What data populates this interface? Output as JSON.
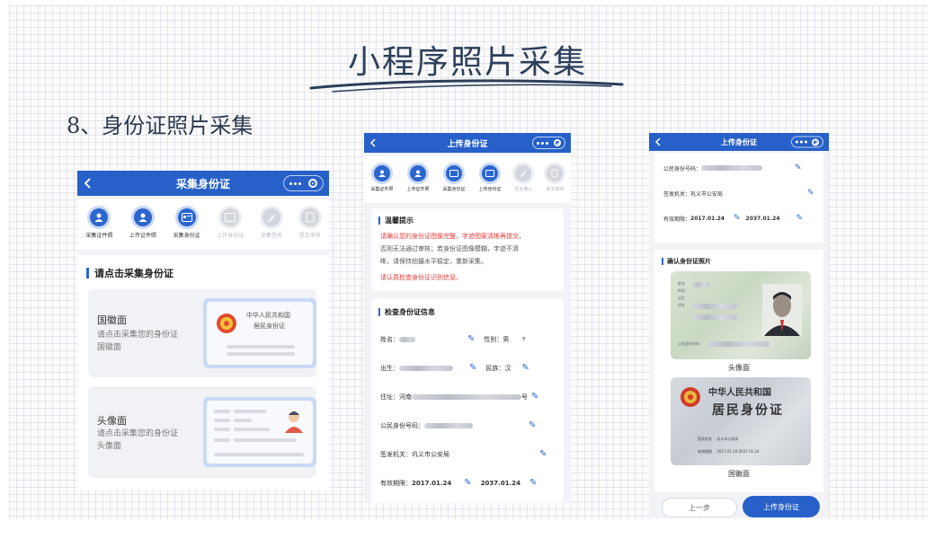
{
  "slide": {
    "title": "小程序照片采集",
    "section_heading": "8、身份证照片采集"
  },
  "colors": {
    "primary": "#2760c8",
    "step_active": "#2c66cf",
    "warning": "#e53a3a"
  },
  "phone1": {
    "nav_title": "采集身份证",
    "steps": [
      {
        "label": "采集证件照",
        "icon": "portrait-icon",
        "active": true
      },
      {
        "label": "上传证件照",
        "icon": "user-upload-icon",
        "active": true
      },
      {
        "label": "采集身份证",
        "icon": "id-card-icon",
        "active": true
      },
      {
        "label": "上传身份证",
        "icon": "id-upload-icon",
        "active": false
      },
      {
        "label": "采集签名",
        "icon": "pen-icon",
        "active": false
      },
      {
        "label": "提交审核",
        "icon": "document-icon",
        "active": false
      }
    ],
    "section_title": "请点击采集身份证",
    "cards": [
      {
        "title": "国徽面",
        "sub1": "请点击采集您的身份证",
        "sub2": "国徽面",
        "card_line1": "中华人民共和国",
        "card_line2": "居民身份证"
      },
      {
        "title": "头像面",
        "sub1": "请点击采集您的身份证",
        "sub2": "头像面"
      }
    ]
  },
  "phone2": {
    "nav_title": "上传身份证",
    "steps": [
      {
        "label": "采集证件照",
        "active": true
      },
      {
        "label": "上传证件照",
        "active": true
      },
      {
        "label": "采集身份证",
        "active": true
      },
      {
        "label": "上传身份证",
        "active": true
      },
      {
        "label": "签名确认",
        "active": false
      },
      {
        "label": "提交审核",
        "active": false
      }
    ],
    "tips_title": "温馨提示",
    "tips_lines": [
      "请确认您的身份证图像完整，字迹图案清晰再提交，",
      "否则无法通过审核；若身份证图像模糊，字迹不清",
      "晰，请保持拍摄水平稳定，重新采集。"
    ],
    "tips_check": "请认真检查身份证识别信息。",
    "info_title": "检查身份证信息",
    "fields": {
      "name_label": "姓名：",
      "gender_label": "性别：",
      "gender_value": "男",
      "birth_label": "出生：",
      "ethnic_label": "民族：",
      "ethnic_value": "汉",
      "address_label": "住址：",
      "address_value": "河南",
      "address_end": "号",
      "idnum_label": "公民身份号码：",
      "authority_label": "签发机关：",
      "authority_value": "巩义市公安局",
      "validity_label": "有效期限：",
      "validity_start": "2017.01.24",
      "validity_end": "2037.01.24"
    }
  },
  "phone3": {
    "nav_title": "上传身份证",
    "fields": {
      "idnum_label": "公民身份号码：",
      "authority_label": "签发机关：",
      "authority_value": "巩义市公安局",
      "validity_label": "有效期限：",
      "validity_start": "2017.01.24",
      "validity_end": "2037.01.24"
    },
    "confirm_title": "确认身份证照片",
    "front_caption": "头像面",
    "front_labels": {
      "name": "姓名",
      "sex": "性别",
      "ethnic": "民族",
      "birth": "出生",
      "address": "住址",
      "idnum": "公民身份号码"
    },
    "back_line1": "中华人民共和国",
    "back_line2": "居民身份证",
    "back_authority_label": "签发机关",
    "back_authority_value": "巩义市公安局",
    "back_validity_label": "有效期限",
    "back_validity_value": "2017.01.24-2037.01.24",
    "back_caption": "国徽面",
    "prev_button": "上一步",
    "next_button": "上传身份证"
  }
}
